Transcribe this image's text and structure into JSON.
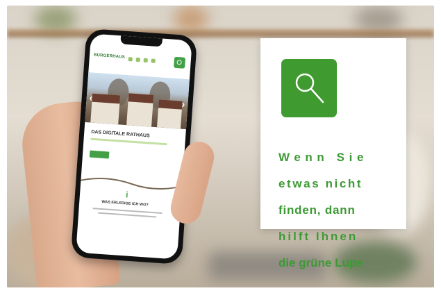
{
  "phone_site": {
    "logo": "BÜRGERHAUS",
    "heading": "DAS DIGITALE RATHAUS",
    "question": "WAS ERLEDIGE ICH WO?"
  },
  "info_card": {
    "icon": "magnifier-icon",
    "icon_bg_color": "#3f9b2f",
    "text_color": "#3c9a34",
    "lines": [
      "Wenn Sie",
      "etwas nicht",
      "finden, dann",
      "hilft Ihnen",
      "die grüne Lupe"
    ]
  }
}
